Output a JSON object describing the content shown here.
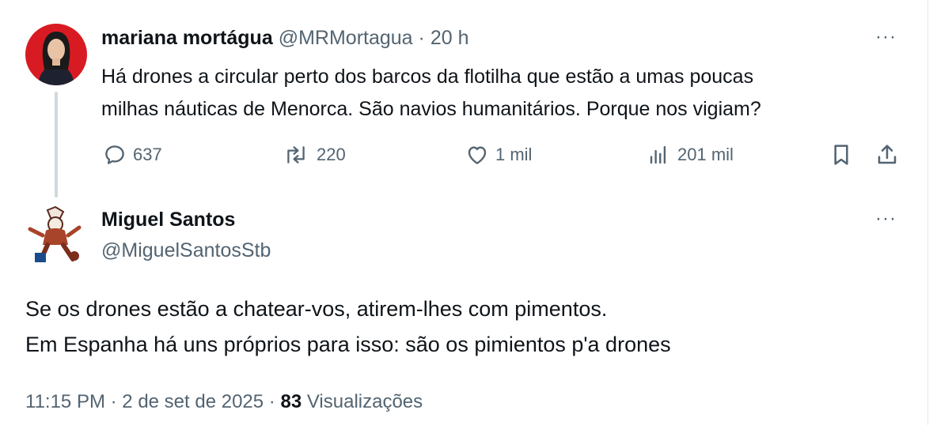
{
  "tweet": {
    "author_name": "mariana mortágua",
    "handle": "@MRMortagua",
    "separator": "·",
    "time": "20 h",
    "text_line1": "Há drones a circular perto dos barcos da flotilha que estão a umas poucas",
    "text_line2": "milhas náuticas de Menorca. São navios humanitários. Porque nos vigiam?",
    "actions": {
      "replies": "637",
      "reposts": "220",
      "likes": "1 mil",
      "views": "201 mil"
    },
    "more_label": "···"
  },
  "reply": {
    "author_name": "Miguel Santos",
    "handle": "@MiguelSantosStb",
    "text_line1": "Se os drones estão a chatear-vos, atirem-lhes com pimentos.",
    "text_line2": "Em Espanha há uns próprios para isso: são os pimientos p'a drones",
    "more_label": "···",
    "meta": {
      "time": "11:15 PM",
      "sep": "·",
      "date": "2 de set de 2025",
      "views_count": "83",
      "views_label": "Visualizações"
    }
  },
  "colors": {
    "text": "#0f1419",
    "muted": "#536471",
    "avatar_bg": "#d81b22",
    "thread_line": "#cfd9de"
  },
  "icons": [
    "reply-icon",
    "repost-icon",
    "like-icon",
    "views-icon",
    "bookmark-icon",
    "share-icon",
    "more-icon"
  ]
}
